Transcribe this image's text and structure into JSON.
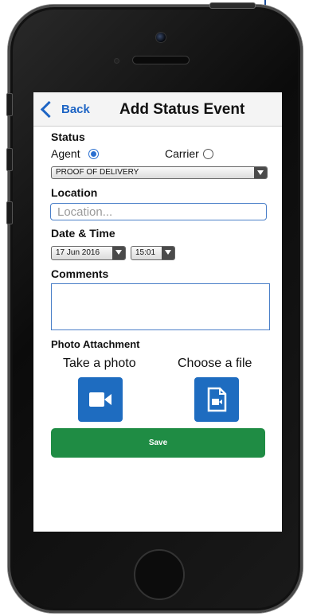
{
  "nav": {
    "back_label": "Back",
    "title": "Add Status Event"
  },
  "status": {
    "label": "Status",
    "option_agent": "Agent",
    "option_carrier": "Carrier",
    "selected": "Agent",
    "type_value": "PROOF OF DELIVERY"
  },
  "location": {
    "label": "Location",
    "placeholder": "Location..."
  },
  "datetime": {
    "label": "Date & Time",
    "date_value": "17 Jun 2016",
    "time_value": "15:01"
  },
  "comments": {
    "label": "Comments",
    "value": ""
  },
  "photo": {
    "label": "Photo Attachment",
    "take_label": "Take a photo",
    "choose_label": "Choose a file"
  },
  "actions": {
    "save_label": "Save"
  },
  "colors": {
    "accent": "#1e6cc0",
    "save": "#1f8c44",
    "back": "#1d64c4"
  },
  "icons": [
    "chevron-left-icon",
    "video-camera-icon",
    "video-file-icon",
    "dropdown-arrow-icon"
  ]
}
